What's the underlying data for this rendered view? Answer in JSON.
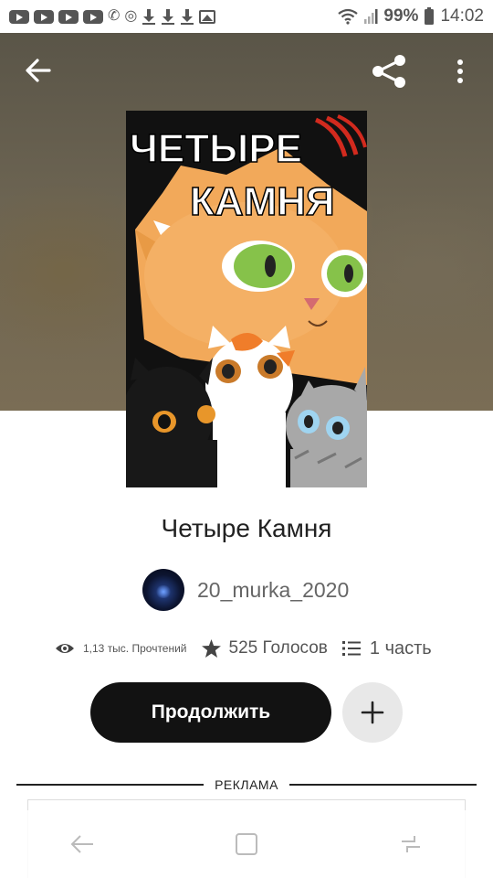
{
  "status_bar": {
    "battery": "99%",
    "time": "14:02"
  },
  "book": {
    "title": "Четыре Камня",
    "cover_title_line1": "ЧЕТЫРЕ",
    "cover_title_line2": "КАМНЯ"
  },
  "author": {
    "name": "20_murka_2020"
  },
  "stats": {
    "reads": "1,13 тыс. Прочтений",
    "votes": "525 Голосов",
    "parts": "1 часть"
  },
  "actions": {
    "continue_label": "Продолжить"
  },
  "ad": {
    "label": "РЕКЛАМА"
  },
  "icons": {
    "back": "arrow-left-icon",
    "share": "share-icon",
    "more": "more-vertical-icon",
    "reads": "eye-icon",
    "votes": "star-icon",
    "parts": "list-icon",
    "add": "plus-icon"
  },
  "colors": {
    "primary_button": "#121212",
    "secondary_button": "#e8e8e8",
    "text": "#222222"
  }
}
